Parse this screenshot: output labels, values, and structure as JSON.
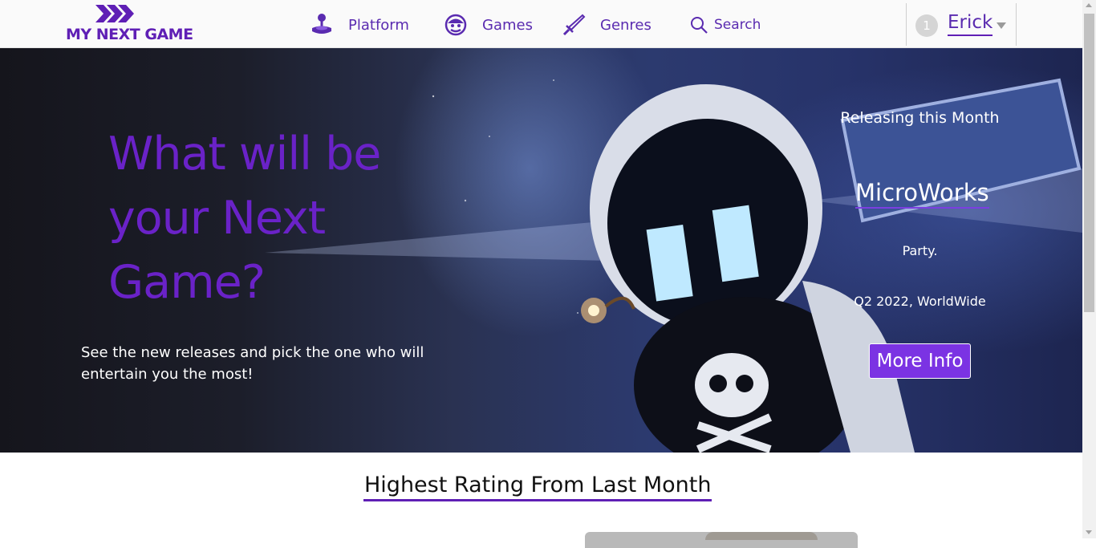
{
  "brand": {
    "logo_text": "MY NEXT GAME",
    "color": "#5f1fb5"
  },
  "nav": {
    "items": [
      {
        "label": "Platform",
        "icon": "joystick-icon"
      },
      {
        "label": "Games",
        "icon": "mario-icon"
      },
      {
        "label": "Genres",
        "icon": "sword-icon"
      },
      {
        "label": "Search",
        "icon": "search-icon"
      }
    ]
  },
  "user": {
    "badge": "1",
    "name": "Erick",
    "icon": "chevron-down-icon"
  },
  "hero": {
    "title": "What will be your Next Game?",
    "subtitle": "See the new releases and pick the one who will entertain you the most!",
    "release_label": "Releasing this Month",
    "game_title": "MicroWorks",
    "genre": "Party.",
    "release_info": "Q2 2022, WorldWide",
    "more_info_label": "More Info"
  },
  "section": {
    "title": "Highest Rating From Last Month"
  },
  "colors": {
    "accent": "#5f1fb5",
    "button": "#7b33e3",
    "hero_title": "#6a22c8"
  }
}
